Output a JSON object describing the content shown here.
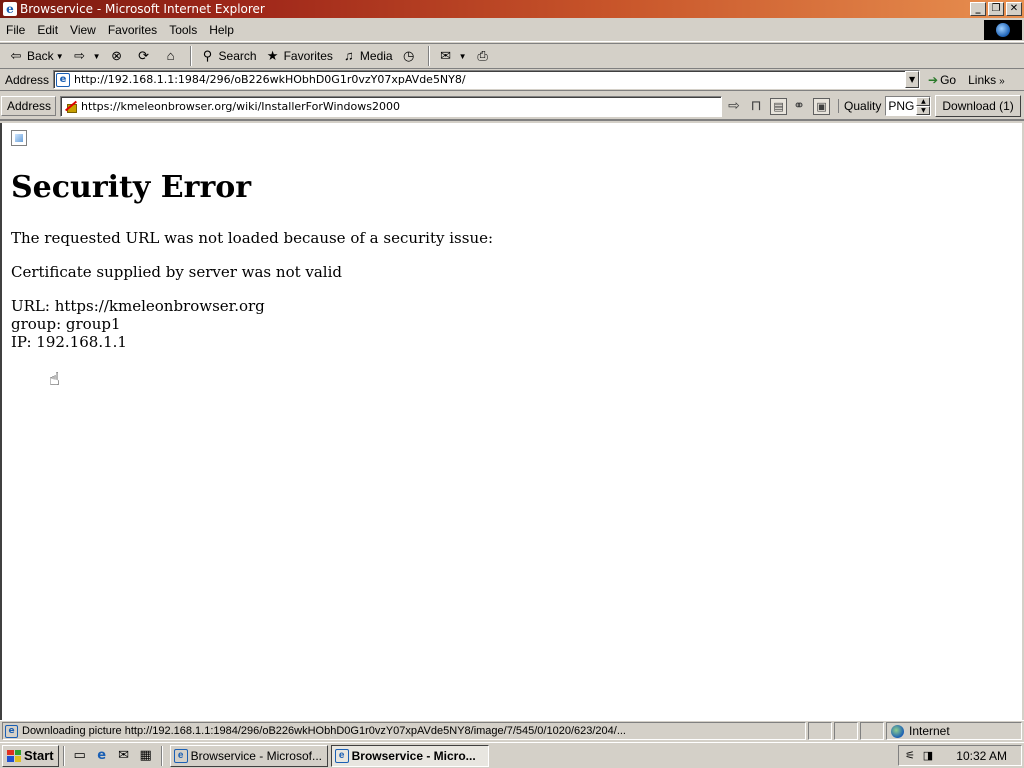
{
  "window": {
    "title": "Browservice - Microsoft Internet Explorer",
    "minimize": "_",
    "maximize": "❐",
    "close": "✕"
  },
  "menu": [
    "File",
    "Edit",
    "View",
    "Favorites",
    "Tools",
    "Help"
  ],
  "toolbar": {
    "back": "Back",
    "search": "Search",
    "favorites": "Favorites",
    "media": "Media"
  },
  "ie_address": {
    "label": "Address",
    "url": "http://192.168.1.1:1984/296/oB226wkHObhD0G1r0vzY07xpAVde5NY8/",
    "go": "Go",
    "links": "Links"
  },
  "proxy_bar": {
    "label": "Address",
    "url": "https://kmeleonbrowser.org/wiki/InstallerForWindows2000",
    "quality_label": "Quality",
    "quality_value": "PNG",
    "download_label": "Download (1)"
  },
  "page": {
    "heading": "Security Error",
    "line1": "The requested URL was not loaded because of a security issue:",
    "line2": "Certificate supplied by server was not valid",
    "url_line": "URL: https://kmeleonbrowser.org",
    "group_line": "group: group1",
    "ip_line": "IP: 192.168.1.1"
  },
  "status": {
    "text": "Downloading picture http://192.168.1.1:1984/296/oB226wkHObhD0G1r0vzY07xpAVde5NY8/image/7/545/0/1020/623/204/...",
    "zone": "Internet"
  },
  "taskbar": {
    "start": "Start",
    "tasks": [
      "Browservice - Microsof...",
      "Browservice - Micro..."
    ],
    "clock": "10:32 AM"
  },
  "colors": {
    "titlebar_start": "#7a1a10",
    "titlebar_end": "#e89050",
    "chrome": "#d4d0c8"
  }
}
